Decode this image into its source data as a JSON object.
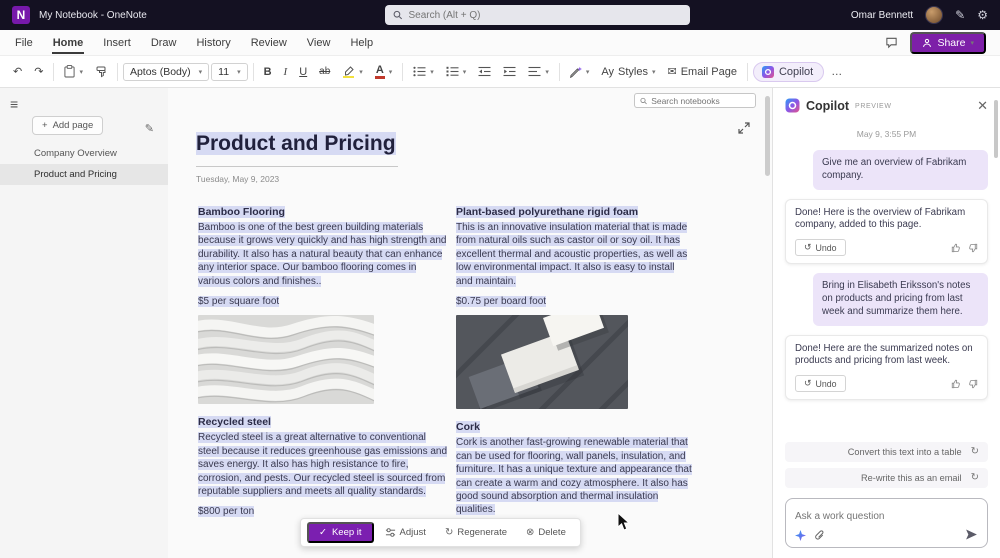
{
  "titlebar": {
    "logo_letter": "N",
    "title": "My Notebook - OneNote",
    "search_placeholder": "Search (Alt + Q)",
    "user_name": "Omar Bennett"
  },
  "menubar": {
    "items": [
      "File",
      "Home",
      "Insert",
      "Draw",
      "History",
      "Review",
      "View",
      "Help"
    ],
    "share_label": "Share"
  },
  "ribbon": {
    "font_name": "Aptos (Body)",
    "font_size": "11",
    "bold": "B",
    "italic": "I",
    "underline": "U",
    "strikethrough": "ab",
    "font_color_letter": "A",
    "styles_icon": "Ay",
    "styles_label": "Styles",
    "email_page_label": "Email Page",
    "copilot_label": "Copilot",
    "more_label": "…"
  },
  "sidebar": {
    "add_page_label": "Add page",
    "pages": [
      {
        "label": "Company Overview"
      },
      {
        "label": "Product and Pricing"
      }
    ]
  },
  "content": {
    "search_placeholder": "Search notebooks",
    "title": "Product and Pricing",
    "date": "Tuesday, May 9, 2023",
    "bamboo_heading": "Bamboo Flooring",
    "bamboo_body": "Bamboo is one of the best green building materials because it grows very quickly and has high strength and durability. It also has a natural beauty that can enhance any interior space. Our bamboo flooring comes in various colors and finishes..",
    "bamboo_price": "$5 per square foot",
    "foam_heading": "Plant-based polyurethane rigid foam",
    "foam_body": "This is an innovative insulation material that is made from natural oils such as castor oil or soy oil. It has excellent thermal and acoustic properties, as well as low environmental impact. It also is easy to install and maintain.",
    "foam_price": "$0.75 per board foot",
    "steel_heading": "Recycled steel",
    "steel_body": "Recycled steel is a great alternative to conventional steel because it reduces greenhouse gas emissions and saves energy. It also has high resistance to fire, corrosion, and pests. Our recycled steel is sourced from reputable suppliers and meets all quality standards.",
    "steel_price": "$800 per ton",
    "cork_heading": "Cork",
    "cork_body": "Cork is another fast-growing renewable material that can be used for flooring, wall panels, insulation, and furniture. It has a unique texture and appearance that can create a warm and cozy atmosphere. It also has good sound absorption and thermal insulation qualities.",
    "toolbar": {
      "keep": "Keep it",
      "adjust": "Adjust",
      "regenerate": "Regenerate",
      "delete": "Delete"
    }
  },
  "copilot": {
    "title": "Copilot",
    "preview": "PREVIEW",
    "timestamp": "May 9, 3:55 PM",
    "messages": [
      {
        "role": "user",
        "text": "Give me an overview of Fabrikam company."
      },
      {
        "role": "assistant",
        "text": "Done! Here is the overview of Fabrikam company, added to this page."
      },
      {
        "role": "user",
        "text": "Bring in Elisabeth Eriksson's notes on products and pricing from last week and summarize them here."
      },
      {
        "role": "assistant",
        "text": "Done! Here are the summarized notes on products and pricing from last week."
      }
    ],
    "undo_label": "Undo",
    "suggestions": [
      "Convert this text into a table",
      "Re-write this as an email"
    ],
    "input_placeholder": "Ask a work question"
  },
  "colors": {
    "accent_purple": "#7719aa",
    "selection_highlight": "#d6daf3",
    "user_bubble": "#ece4f9",
    "titlebar_bg": "#141122"
  }
}
